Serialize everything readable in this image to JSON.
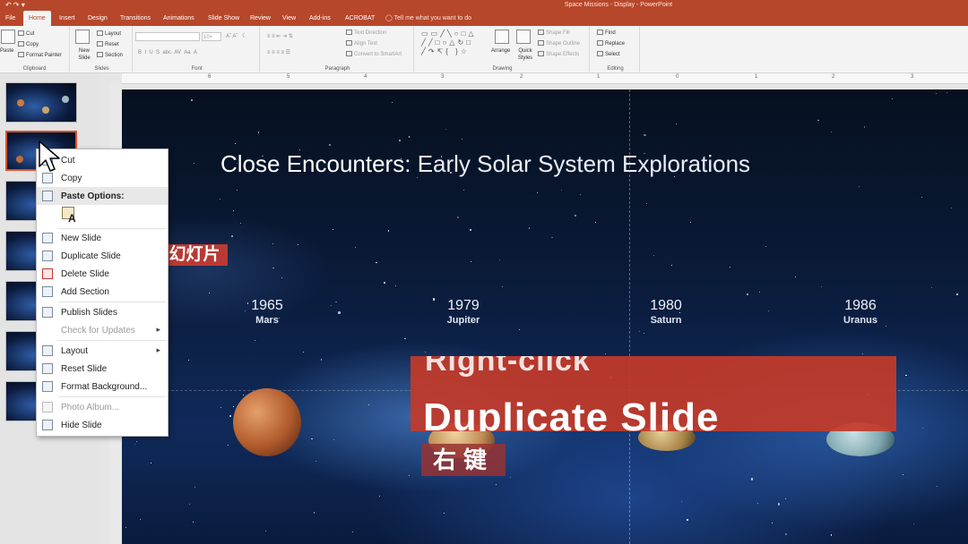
{
  "window": {
    "title": "Space Missions - Display - PowerPoint",
    "quick_access": "↶ ↷ ▾"
  },
  "tabs": [
    "File",
    "Home",
    "Insert",
    "Design",
    "Transitions",
    "Animations",
    "Slide Show",
    "Review",
    "View",
    "Add-ins",
    "ACROBAT"
  ],
  "tell_me": "Tell me what you want to do",
  "ribbon": {
    "clipboard": {
      "paste": "Paste",
      "cut": "Cut",
      "copy": "Copy",
      "format_painter": "Format Painter",
      "label": "Clipboard"
    },
    "slides": {
      "new_slide": "New Slide",
      "layout": "Layout",
      "reset": "Reset",
      "section": "Section",
      "label": "Slides"
    },
    "font": {
      "size": "10+",
      "label": "Font"
    },
    "paragraph": {
      "text_direction": "Text Direction",
      "align_text": "Align Text",
      "convert_smartart": "Convert to SmartArt",
      "label": "Paragraph"
    },
    "drawing": {
      "arrange": "Arrange",
      "quick_styles": "Quick Styles",
      "shape_fill": "Shape Fill",
      "shape_outline": "Shape Outline",
      "shape_effects": "Shape Effects",
      "label": "Drawing"
    },
    "editing": {
      "find": "Find",
      "replace": "Replace",
      "select": "Select",
      "label": "Editing"
    }
  },
  "ruler": [
    "6",
    "5",
    "4",
    "3",
    "2",
    "1",
    "0",
    "1",
    "2",
    "3"
  ],
  "slide": {
    "title_bold": "Close Encounters:",
    "title_light": "Early Solar System Explorations",
    "timeline": [
      {
        "year": "1965",
        "planet": "Mars"
      },
      {
        "year": "1979",
        "planet": "Jupiter"
      },
      {
        "year": "1980",
        "planet": "Saturn"
      },
      {
        "year": "1986",
        "planet": "Uranus"
      }
    ]
  },
  "context_menu": {
    "items": [
      {
        "label": "Cut",
        "icon": "scissors-icon"
      },
      {
        "label": "Copy",
        "icon": "copy-icon"
      },
      {
        "label": "Paste Options:",
        "icon": "paste-icon"
      },
      {
        "label": "New Slide",
        "icon": "new-slide-icon"
      },
      {
        "label": "Duplicate Slide",
        "icon": "duplicate-slide-icon"
      },
      {
        "label": "Delete Slide",
        "icon": "delete-slide-icon"
      },
      {
        "label": "Add Section",
        "icon": "add-section-icon"
      },
      {
        "label": "Publish Slides",
        "icon": "publish-slides-icon"
      },
      {
        "label": "Check for Updates",
        "icon": "none"
      },
      {
        "label": "Layout",
        "icon": "layout-icon"
      },
      {
        "label": "Reset Slide",
        "icon": "reset-slide-icon"
      },
      {
        "label": "Format Background...",
        "icon": "format-background-icon"
      },
      {
        "label": "Photo Album...",
        "icon": "photo-album-icon"
      },
      {
        "label": "Hide Slide",
        "icon": "hide-slide-icon"
      }
    ],
    "paste_letter": "A"
  },
  "captions": {
    "line1": "Right-click",
    "line2": "Duplicate Slide",
    "chinese_right_click": "右键",
    "chinese_duplicate": "复制幻灯片"
  },
  "colors": {
    "accent": "#b7472a",
    "caption_red": "#c33a2a",
    "slide_bg": "#0a1a38"
  }
}
